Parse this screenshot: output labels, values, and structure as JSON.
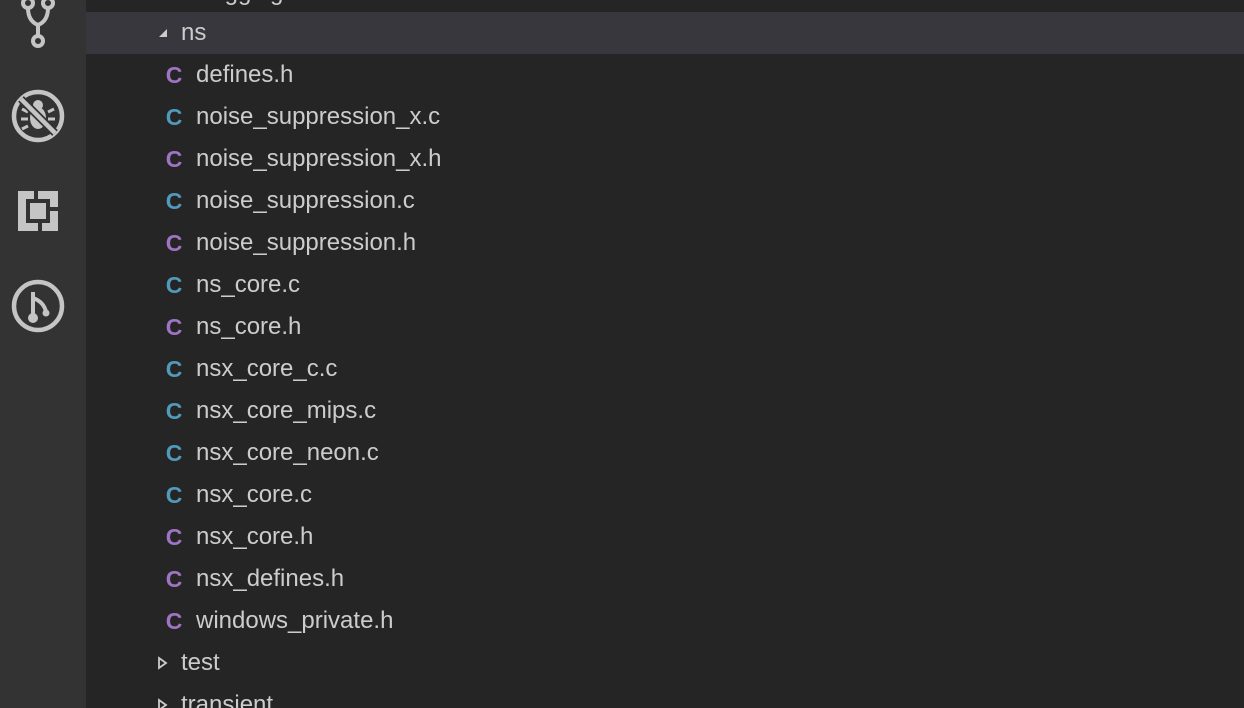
{
  "activity_bar": {
    "icons": [
      "source-control-icon",
      "debug-icon",
      "extensions-icon",
      "git-history-icon"
    ]
  },
  "explorer": {
    "cut_off_folder": "logging",
    "open_folder": "ns",
    "files": [
      {
        "name": "defines.h",
        "ext": "h"
      },
      {
        "name": "noise_suppression_x.c",
        "ext": "c"
      },
      {
        "name": "noise_suppression_x.h",
        "ext": "h"
      },
      {
        "name": "noise_suppression.c",
        "ext": "c"
      },
      {
        "name": "noise_suppression.h",
        "ext": "h"
      },
      {
        "name": "ns_core.c",
        "ext": "c"
      },
      {
        "name": "ns_core.h",
        "ext": "h"
      },
      {
        "name": "nsx_core_c.c",
        "ext": "c"
      },
      {
        "name": "nsx_core_mips.c",
        "ext": "c"
      },
      {
        "name": "nsx_core_neon.c",
        "ext": "c"
      },
      {
        "name": "nsx_core.c",
        "ext": "c"
      },
      {
        "name": "nsx_core.h",
        "ext": "h"
      },
      {
        "name": "nsx_defines.h",
        "ext": "h"
      },
      {
        "name": "windows_private.h",
        "ext": "h"
      }
    ],
    "file_icon_glyph": "C",
    "closed_folders": [
      "test",
      "transient"
    ]
  },
  "colors": {
    "c_file_icon": "#519aba",
    "h_file_icon": "#a074c4",
    "selected_row": "#37373d"
  }
}
